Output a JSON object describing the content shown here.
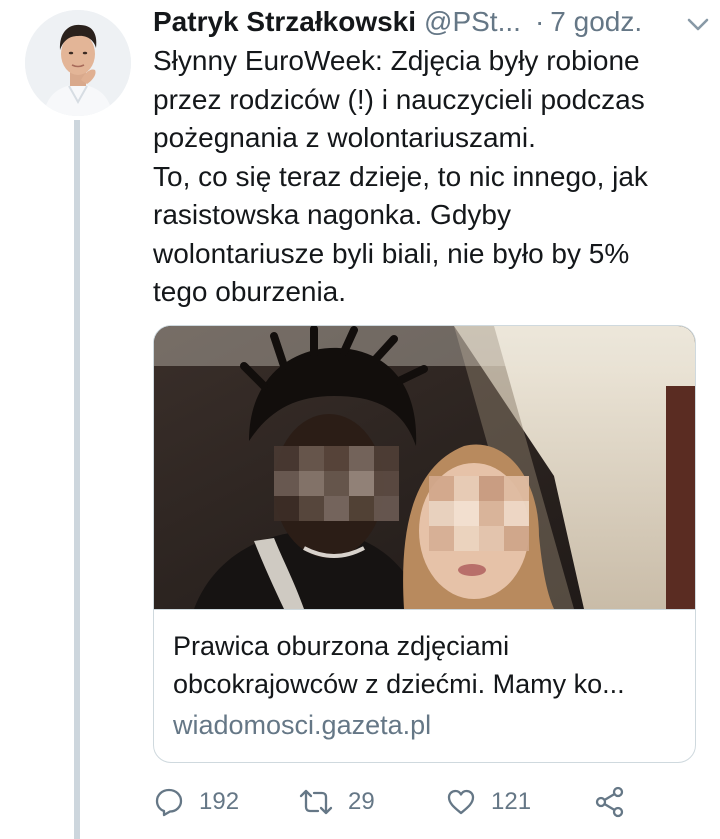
{
  "tweet": {
    "author_name": "Patryk Strzałkowski",
    "author_handle": "@PSt...",
    "separator": "·",
    "time": "7 godz.",
    "text_lines": [
      "Słynny EuroWeek:  Zdjęcia były robione",
      "przez rodziców (!) i nauczycieli podczas",
      "pożegnania z wolontariuszami.",
      "To, co się teraz dzieje, to nic innego, jak",
      "rasistowska nagonka. Gdyby",
      "wolontariusze byli biali, nie było by 5%",
      "tego oburzenia."
    ],
    "card": {
      "title_lines": [
        "Prawica oburzona zdjęciami",
        "obcokrajowców z dziećmi. Mamy ko..."
      ],
      "domain": "wiadomosci.gazeta.pl"
    },
    "actions": {
      "replies": "192",
      "retweets": "29",
      "likes": "121"
    }
  },
  "icons": {
    "reply": "reply-icon",
    "retweet": "retweet-icon",
    "like": "heart-icon",
    "share": "share-icon",
    "menu": "chevron-down-icon"
  },
  "colors": {
    "secondary_text": "#657786",
    "border": "#cfd9de",
    "thread_line": "#cdd6dd",
    "primary_text": "#14171a"
  }
}
